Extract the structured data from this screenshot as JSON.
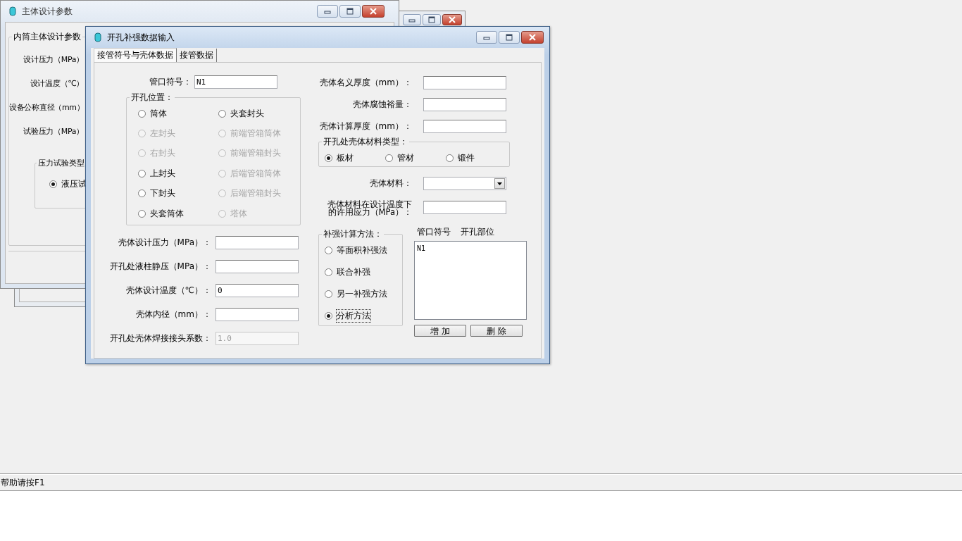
{
  "back_window": {
    "title": "主体设计参数",
    "group_title": "内筒主体设计参数",
    "labels": [
      "设计压力（MPa）",
      "设计温度（℃）",
      "设备公称直径（mm）",
      "试验压力（MPa）"
    ],
    "test_group": {
      "title": "压力试验类型",
      "options": [
        {
          "label": "液压试",
          "selected": true
        }
      ]
    }
  },
  "dialog": {
    "title": "开孔补强数据输入",
    "tabs": [
      {
        "label": "接管符号与壳体数据",
        "selected": true
      },
      {
        "label": "接管数据",
        "selected": false
      }
    ],
    "nozzle_symbol": {
      "label": "管口符号：",
      "value": "N1"
    },
    "position_group": {
      "title": "开孔位置：",
      "options": [
        {
          "label": "筒体",
          "selected": false,
          "disabled": false
        },
        {
          "label": "夹套封头",
          "selected": false,
          "disabled": false
        },
        {
          "label": "左封头",
          "selected": false,
          "disabled": true
        },
        {
          "label": "前端管箱筒体",
          "selected": false,
          "disabled": true
        },
        {
          "label": "右封头",
          "selected": false,
          "disabled": true
        },
        {
          "label": "前端管箱封头",
          "selected": false,
          "disabled": true
        },
        {
          "label": "上封头",
          "selected": false,
          "disabled": false
        },
        {
          "label": "后端管箱筒体",
          "selected": false,
          "disabled": true
        },
        {
          "label": "下封头",
          "selected": false,
          "disabled": false
        },
        {
          "label": "后端管箱封头",
          "selected": false,
          "disabled": true
        },
        {
          "label": "夹套筒体",
          "selected": false,
          "disabled": false
        },
        {
          "label": "塔体",
          "selected": false,
          "disabled": true
        }
      ]
    },
    "left_fields": [
      {
        "label": "壳体设计压力（MPa）：",
        "disabled": false
      },
      {
        "label": "开孔处液柱静压（MPa）：",
        "disabled": false
      },
      {
        "label": "壳体设计温度（℃）：",
        "value": "0",
        "disabled": false
      },
      {
        "label": "壳体内径（mm）：",
        "disabled": false
      },
      {
        "label": "开孔处壳体焊接接头系数：",
        "value": "1.0",
        "disabled": true
      }
    ],
    "right_fields": [
      {
        "label": "壳体名义厚度（mm）："
      },
      {
        "label": "壳体腐蚀裕量："
      },
      {
        "label": "壳体计算厚度（mm）："
      }
    ],
    "material_type_group": {
      "title": "开孔处壳体材料类型：",
      "options": [
        {
          "label": "板材",
          "selected": true
        },
        {
          "label": "管材",
          "selected": false
        },
        {
          "label": "锻件",
          "selected": false
        }
      ]
    },
    "material": {
      "label": "壳体材料："
    },
    "allowable_stress": {
      "label": "壳体材料在设计温度下的许用应力（MPa）："
    },
    "method_group": {
      "title": "补强计算方法：",
      "options": [
        {
          "label": "等面积补强法",
          "selected": false,
          "focused": false
        },
        {
          "label": "联合补强",
          "selected": false,
          "focused": false
        },
        {
          "label": "另一补强方法",
          "selected": false,
          "focused": false
        },
        {
          "label": "分析方法",
          "selected": true,
          "focused": true
        }
      ]
    },
    "nozzle_list": {
      "columns": [
        "管口符号",
        "开孔部位"
      ],
      "rows": [
        {
          "symbol": "N1"
        }
      ]
    },
    "buttons": [
      "增 加",
      "删 除"
    ]
  },
  "status_bar": {
    "text": "帮助请按F1"
  }
}
